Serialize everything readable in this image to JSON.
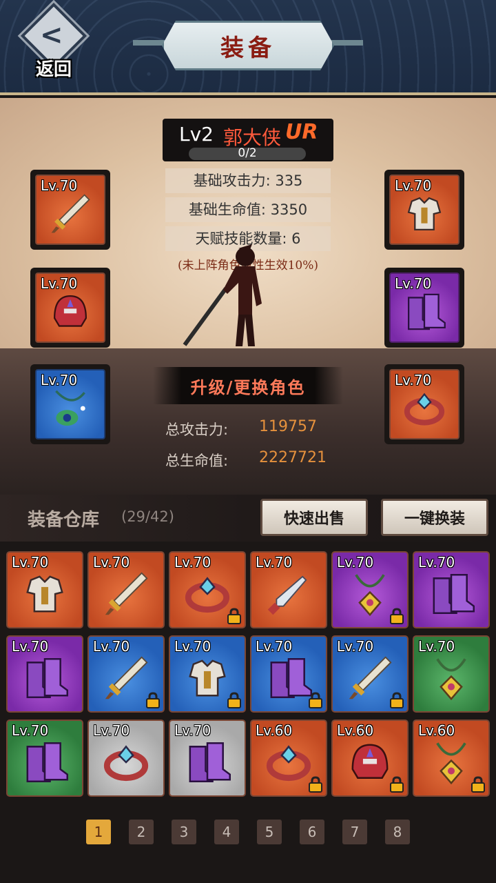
{
  "header": {
    "back_label": "返回",
    "title": "装备"
  },
  "hero": {
    "level": "Lv2",
    "name": "郭大侠",
    "grade": "UR",
    "progress_text": "0/2",
    "progress": 0,
    "stats": [
      "基础攻击力: 335",
      "基础生命值: 3350",
      "天赋技能数量: 6"
    ],
    "note": "(未上阵角色属性生效10%)"
  },
  "equipped": [
    {
      "level": "Lv.70",
      "quality": "orange",
      "icon": "sword-icon"
    },
    {
      "level": "Lv.70",
      "quality": "orange",
      "icon": "helmet-icon"
    },
    {
      "level": "Lv.70",
      "quality": "blue",
      "icon": "peacock-necklace-icon"
    },
    {
      "level": "Lv.70",
      "quality": "orange",
      "icon": "armor-icon"
    },
    {
      "level": "Lv.70",
      "quality": "purple",
      "icon": "boots-icon"
    },
    {
      "level": "Lv.70",
      "quality": "orange",
      "icon": "ring-icon"
    }
  ],
  "upgrade_label": "升级/更换角色",
  "power": {
    "attack_label": "总攻击力:",
    "attack_value": "119757",
    "hp_label": "总生命值:",
    "hp_value": "2227721"
  },
  "warehouse": {
    "title": "装备仓库",
    "count": "(29/42)",
    "quick_sell": "快速出售",
    "auto_equip": "一键换装",
    "items": [
      {
        "level": "Lv.70",
        "quality": "orange",
        "icon": "armor-icon",
        "locked": false
      },
      {
        "level": "Lv.70",
        "quality": "orange",
        "icon": "sword-icon",
        "locked": false
      },
      {
        "level": "Lv.70",
        "quality": "orange",
        "icon": "ring-icon",
        "locked": true
      },
      {
        "level": "Lv.70",
        "quality": "orange",
        "icon": "dagger-icon",
        "locked": false
      },
      {
        "level": "Lv.70",
        "quality": "purple",
        "icon": "necklace-icon",
        "locked": true
      },
      {
        "level": "Lv.70",
        "quality": "purple",
        "icon": "boots-icon",
        "locked": false
      },
      {
        "level": "Lv.70",
        "quality": "purple",
        "icon": "boots-icon",
        "locked": false
      },
      {
        "level": "Lv.70",
        "quality": "blue",
        "icon": "sword-icon",
        "locked": true
      },
      {
        "level": "Lv.70",
        "quality": "blue",
        "icon": "armor-icon",
        "locked": true
      },
      {
        "level": "Lv.70",
        "quality": "blue",
        "icon": "boots-icon",
        "locked": true
      },
      {
        "level": "Lv.70",
        "quality": "blue",
        "icon": "sword-icon",
        "locked": true
      },
      {
        "level": "Lv.70",
        "quality": "green",
        "icon": "necklace-icon",
        "locked": false
      },
      {
        "level": "Lv.70",
        "quality": "green",
        "icon": "boots-icon",
        "locked": false
      },
      {
        "level": "Lv.70",
        "quality": "grey",
        "icon": "ring-icon",
        "locked": false
      },
      {
        "level": "Lv.70",
        "quality": "grey",
        "icon": "boots-icon",
        "locked": false
      },
      {
        "level": "Lv.60",
        "quality": "orange",
        "icon": "ring-icon",
        "locked": true
      },
      {
        "level": "Lv.60",
        "quality": "orange",
        "icon": "helmet-icon",
        "locked": true
      },
      {
        "level": "Lv.60",
        "quality": "orange",
        "icon": "necklace-icon",
        "locked": true
      }
    ]
  },
  "pager": {
    "pages": [
      "1",
      "2",
      "3",
      "4",
      "5",
      "6",
      "7",
      "8"
    ],
    "active": "1"
  }
}
